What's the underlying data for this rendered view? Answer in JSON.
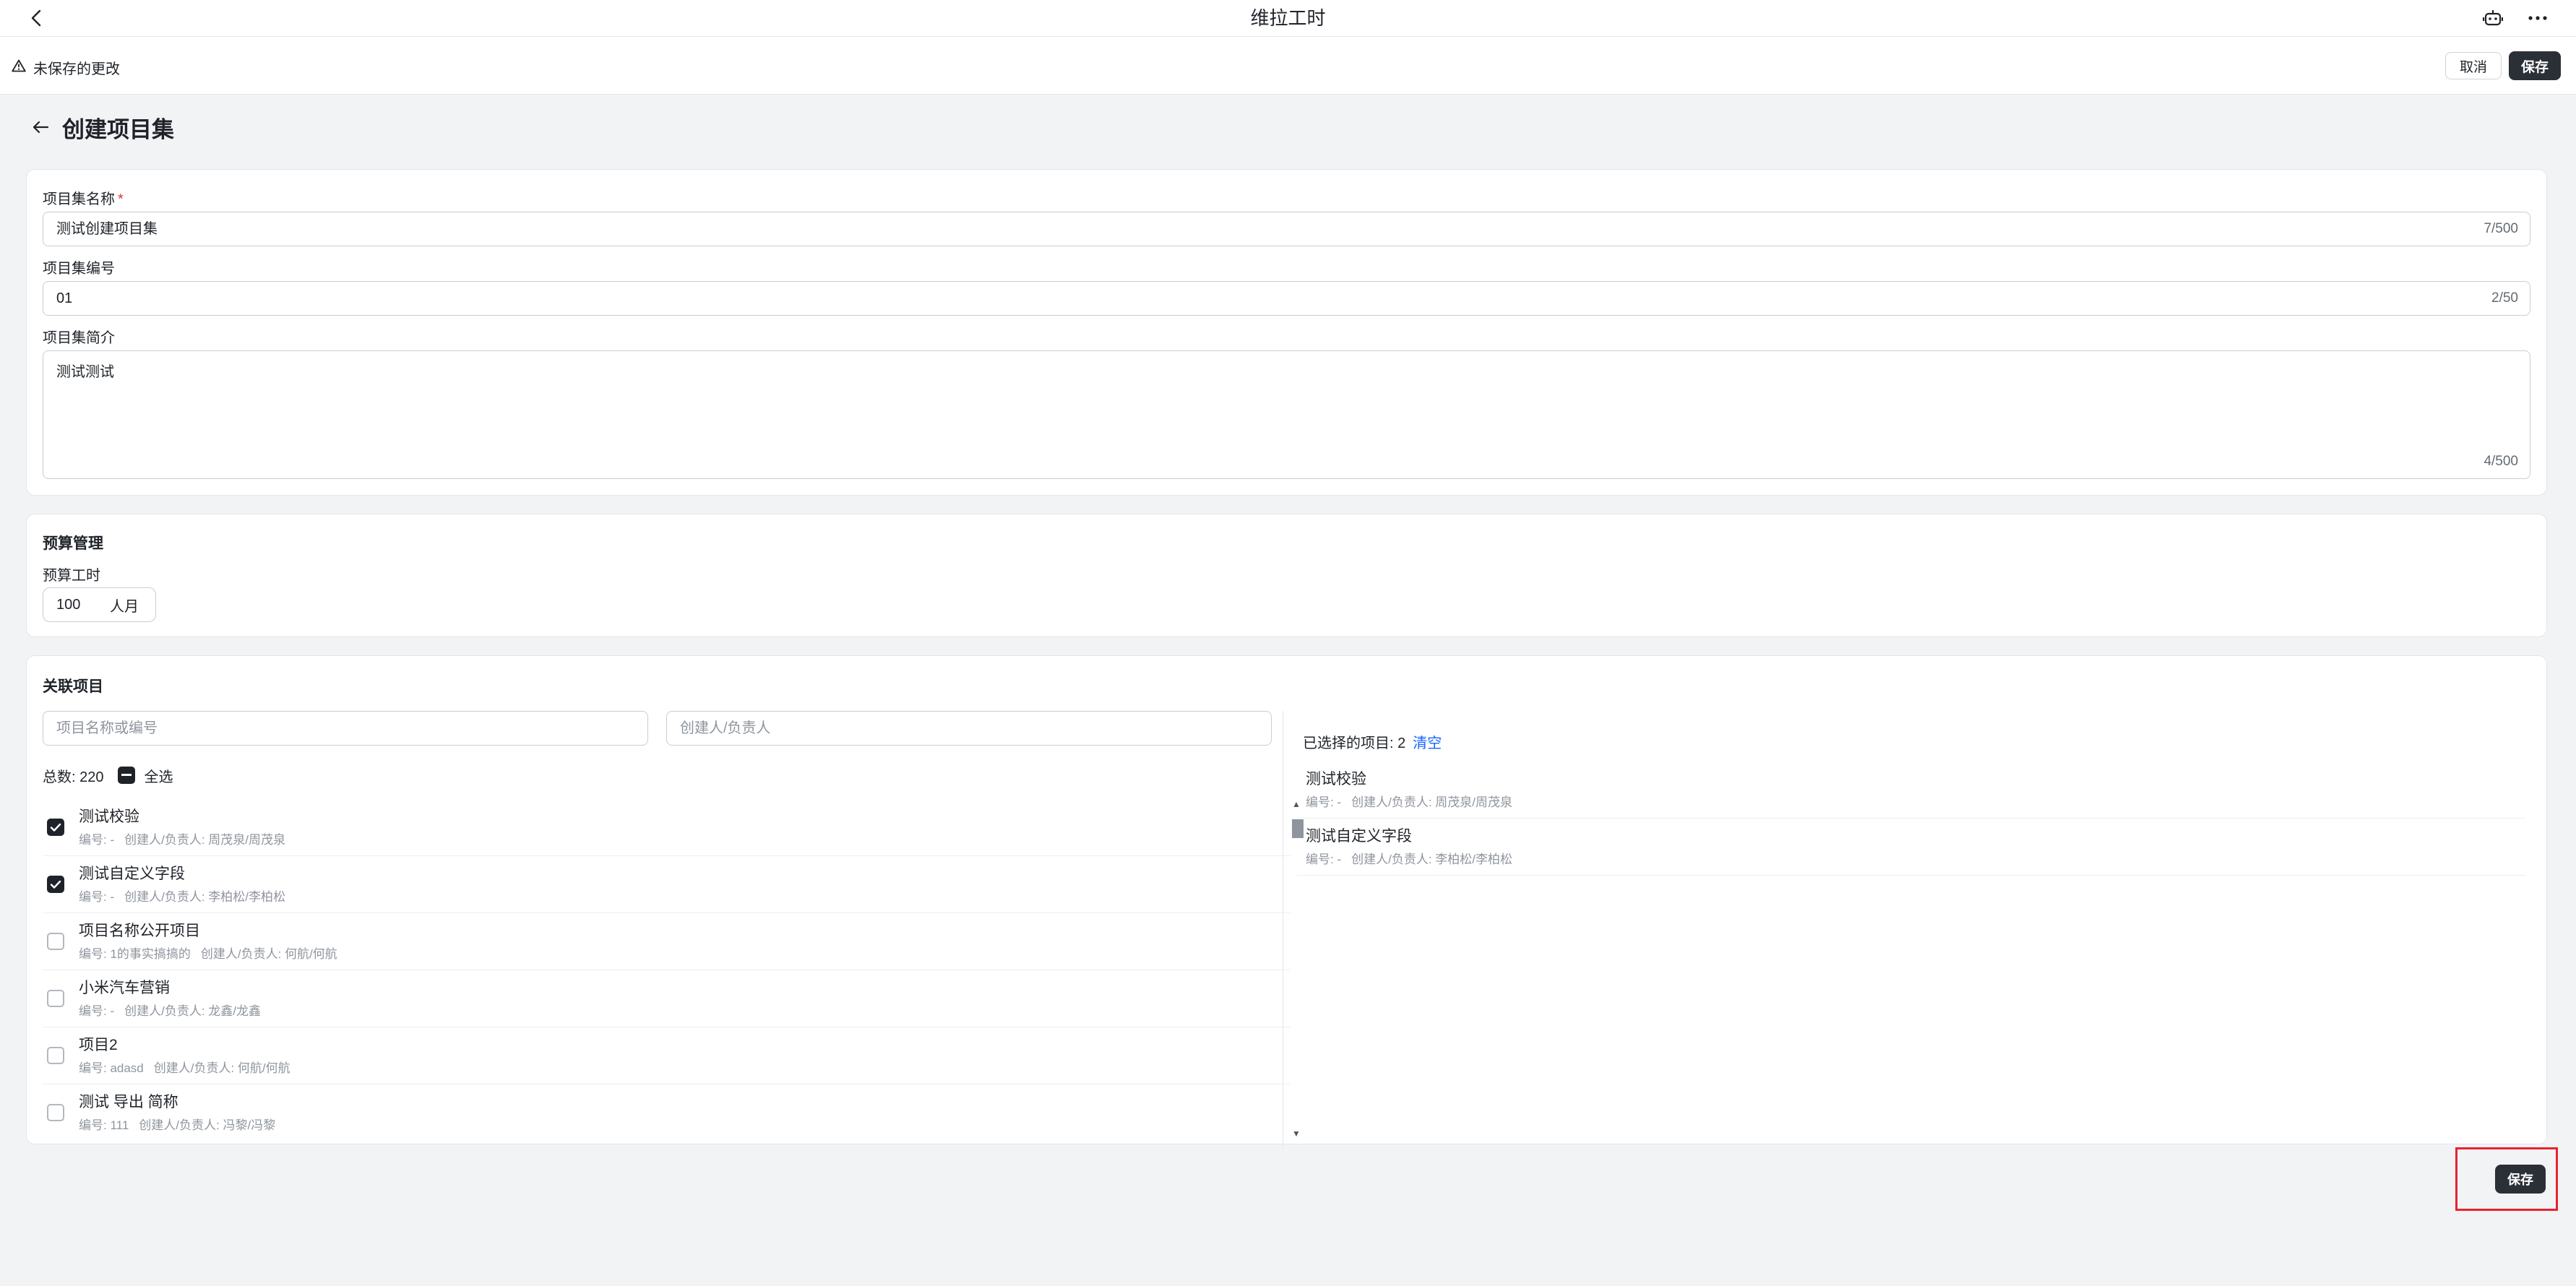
{
  "app": {
    "title": "维拉工时"
  },
  "unsaved": {
    "message": "未保存的更改",
    "cancel_label": "取消",
    "save_label": "保存"
  },
  "page": {
    "title": "创建项目集"
  },
  "form": {
    "name": {
      "label": "项目集名称",
      "required_mark": "*",
      "value": "测试创建项目集",
      "counter": "7/500"
    },
    "code": {
      "label": "项目集编号",
      "value": "01",
      "counter": "2/50"
    },
    "intro": {
      "label": "项目集简介",
      "value": "测试测试",
      "counter": "4/500"
    }
  },
  "budget": {
    "section_title": "预算管理",
    "label": "预算工时",
    "value": "100",
    "unit": "人月"
  },
  "related": {
    "section_title": "关联项目",
    "search_name_placeholder": "项目名称或编号",
    "search_owner_placeholder": "创建人/负责人",
    "total_label": "总数: 220",
    "select_all_label": "全选",
    "items": [
      {
        "name": "测试校验",
        "code": "编号: -",
        "owner": "创建人/负责人: 周茂泉/周茂泉",
        "checked": true
      },
      {
        "name": "测试自定义字段",
        "code": "编号: -",
        "owner": "创建人/负责人: 李柏松/李柏松",
        "checked": true
      },
      {
        "name": "项目名称公开项目",
        "code": "编号: 1的事实搞搞的",
        "owner": "创建人/负责人: 何航/何航",
        "checked": false
      },
      {
        "name": "小米汽车营销",
        "code": "编号: -",
        "owner": "创建人/负责人: 龙鑫/龙鑫",
        "checked": false
      },
      {
        "name": "项目2",
        "code": "编号: adasd",
        "owner": "创建人/负责人: 何航/何航",
        "checked": false
      },
      {
        "name": "测试 导出 简称",
        "code": "编号: 111",
        "owner": "创建人/负责人: 冯黎/冯黎",
        "checked": false
      }
    ],
    "selected_label": "已选择的项目: 2",
    "clear_label": "清空",
    "selected_items": [
      {
        "name": "测试校验",
        "code": "编号: -",
        "owner": "创建人/负责人: 周茂泉/周茂泉"
      },
      {
        "name": "测试自定义字段",
        "code": "编号: -",
        "owner": "创建人/负责人: 李柏松/李柏松"
      }
    ]
  },
  "footer": {
    "save_label": "保存"
  },
  "colors": {
    "accent": "#1664ff",
    "dark_button": "#2b2f36",
    "highlight": "#e8232e"
  }
}
